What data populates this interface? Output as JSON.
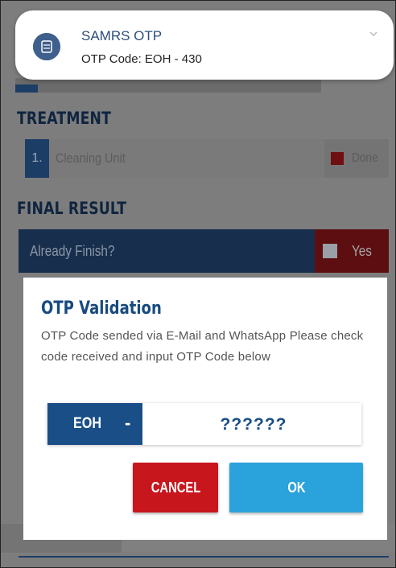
{
  "notification": {
    "app": "SAMRS OTP",
    "text": "OTP Code: EOH - 430",
    "icon": "samrs-app-icon"
  },
  "background": {
    "treatment_title": "TREATMENT",
    "treatment_items": [
      {
        "number": "1.",
        "label": "Cleaning Unit",
        "status": "Done"
      }
    ],
    "final_result_title": "FINAL RESULT",
    "final_result_question": "Already Finish?",
    "final_result_answer": "Yes"
  },
  "dialog": {
    "title": "OTP Validation",
    "message": "OTP Code sended via E-Mail and WhatsApp Please check code received and input OTP Code below",
    "prefix": "EOH",
    "separator": "-",
    "input_placeholder": "??????",
    "cancel_label": "CANCEL",
    "ok_label": "OK"
  },
  "colors": {
    "primary": "#1a4e86",
    "cancel": "#c8161d",
    "ok": "#2aa2dc"
  }
}
